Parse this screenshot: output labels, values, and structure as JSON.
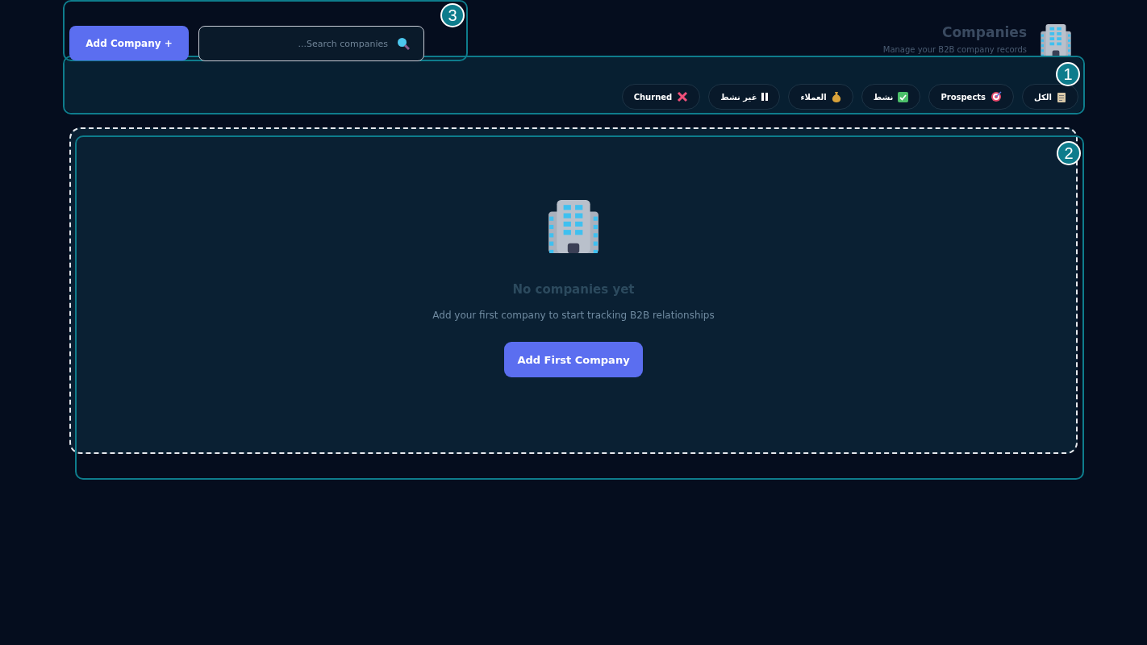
{
  "header": {
    "title": "Companies",
    "subtitle": "Manage your B2B company records",
    "add_button": "Add Company +",
    "search": {
      "placeholder": "Search companies..."
    },
    "annotation": "3"
  },
  "filters": {
    "annotation": "1",
    "chips": [
      {
        "label": "الكل"
      },
      {
        "label": "Prospects"
      },
      {
        "label": "نشط"
      },
      {
        "label": "العملاء"
      },
      {
        "label": "غير نشط"
      },
      {
        "label": "Churned"
      }
    ]
  },
  "empty_state": {
    "annotation": "2",
    "title": "No companies yet",
    "message": "Add your first company to start tracking B2B relationships",
    "button": "Add First Company"
  }
}
